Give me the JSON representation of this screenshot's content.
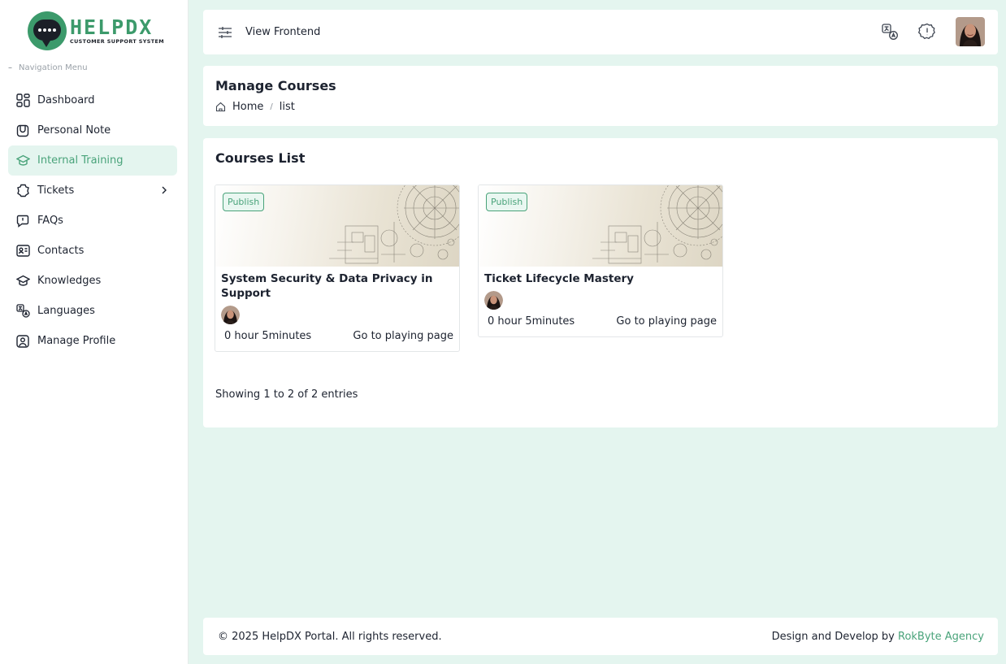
{
  "brand": {
    "name": "HELPDX",
    "tagline": "CUSTOMER SUPPORT SYSTEM",
    "accent_color": "#49a37a"
  },
  "sidebar": {
    "heading": "Navigation Menu",
    "items": [
      {
        "label": "Dashboard",
        "icon": "dashboard-icon",
        "active": false
      },
      {
        "label": "Personal Note",
        "icon": "note-icon",
        "active": false
      },
      {
        "label": "Internal Training",
        "icon": "graduation-cap-icon",
        "active": true
      },
      {
        "label": "Tickets",
        "icon": "ticket-icon",
        "active": false,
        "has_submenu": true
      },
      {
        "label": "FAQs",
        "icon": "faq-icon",
        "active": false
      },
      {
        "label": "Contacts",
        "icon": "contact-card-icon",
        "active": false
      },
      {
        "label": "Knowledges",
        "icon": "knowledge-icon",
        "active": false
      },
      {
        "label": "Languages",
        "icon": "translate-icon",
        "active": false
      },
      {
        "label": "Manage Profile",
        "icon": "user-profile-icon",
        "active": false
      }
    ]
  },
  "topbar": {
    "view_frontend": "View Frontend",
    "icons": [
      "menu-toggle-icon",
      "language-icon",
      "alert-icon",
      "user-avatar"
    ]
  },
  "page": {
    "title": "Manage Courses",
    "breadcrumb": {
      "home": "Home",
      "current": "list"
    }
  },
  "courses": {
    "title": "Courses List",
    "items": [
      {
        "status": "Publish",
        "title": "System Security & Data Privacy in Support",
        "duration": "0 hour 5minutes",
        "action": "Go to playing page"
      },
      {
        "status": "Publish",
        "title": "Ticket Lifecycle Mastery",
        "duration": "0 hour 5minutes",
        "action": "Go to playing page"
      }
    ],
    "showing": "Showing 1 to 2 of 2 entries"
  },
  "footer": {
    "copyright": "© 2025 HelpDX Portal. All rights reserved.",
    "credit_prefix": "Design and Develop by",
    "credit_link": "RokByte Agency"
  }
}
